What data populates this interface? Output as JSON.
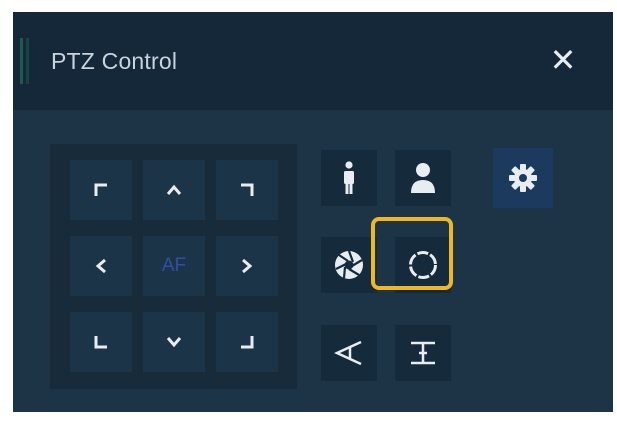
{
  "window": {
    "title": "PTZ Control",
    "close_icon": "close-icon"
  },
  "dpad": {
    "center_label": "AF",
    "buttons": [
      "up-left-corner-icon",
      "up-chevron-icon",
      "up-right-corner-icon",
      "left-chevron-icon",
      "right-chevron-icon",
      "down-left-corner-icon",
      "down-chevron-icon",
      "down-right-corner-icon"
    ]
  },
  "tools": {
    "row1": [
      "person-full-body-icon",
      "person-bust-icon"
    ],
    "row2": [
      "iris-aperture-icon",
      "focus-ring-icon"
    ],
    "row3": [
      "zoom-wide-icon",
      "zoom-tele-icon"
    ],
    "settings": "gear-icon"
  },
  "colors": {
    "panel_bg": "#1d3346",
    "header_bg": "#14283a",
    "highlight": "#f1b625",
    "af_text": "#2f4fa6",
    "settings_bg": "#1b3a5e"
  }
}
